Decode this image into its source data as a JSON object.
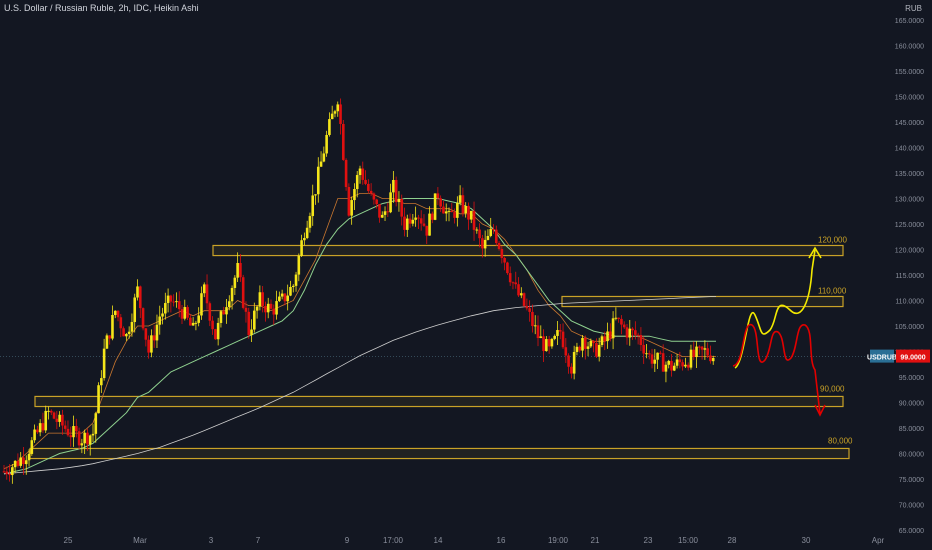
{
  "header": {
    "symbol_title": "U.S. Dollar / Russian Ruble, 2h, IDC, Heikin Ashi",
    "currency": "RUB"
  },
  "chart_data": {
    "type": "candlestick",
    "title": "U.S. Dollar / Russian Ruble, 2h, IDC, Heikin Ashi",
    "ylim": [
      65,
      165
    ],
    "y_ticks": [
      "165.0000",
      "160.0000",
      "155.0000",
      "150.0000",
      "145.0000",
      "140.0000",
      "135.0000",
      "130.0000",
      "125.0000",
      "120.0000",
      "115.0000",
      "110.0000",
      "105.0000",
      "100.0000",
      "95.0000",
      "90.0000",
      "85.0000",
      "80.0000",
      "75.0000",
      "70.0000",
      "65.0000"
    ],
    "y_tick_values": [
      165,
      160,
      155,
      150,
      145,
      140,
      135,
      130,
      125,
      120,
      115,
      110,
      105,
      100,
      95,
      90,
      85,
      80,
      75,
      70,
      65
    ],
    "x_ticks": [
      "25",
      "Mar",
      "3",
      "7",
      "9",
      "17:00",
      "14",
      "16",
      "19:00",
      "21",
      "23",
      "15:00",
      "28",
      "30",
      "Apr"
    ],
    "price_label": {
      "name": "USDRUB",
      "value": "99.0000",
      "price": 99
    },
    "zones": [
      {
        "label": "120,000",
        "low": 119.4,
        "high": 120.2
      },
      {
        "label": "110,000",
        "low": 109.4,
        "high": 110.2
      },
      {
        "label": "90,000",
        "low": 89.8,
        "high": 90.6
      },
      {
        "label": "80,000",
        "low": 79.6,
        "high": 80.4
      }
    ],
    "series": [
      {
        "name": "price_path",
        "values": [
          76.5,
          78,
          80,
          84,
          88,
          86,
          84,
          83,
          84,
          100,
          108,
          103,
          112,
          100,
          107,
          110,
          108,
          104,
          112,
          103,
          110,
          116,
          104,
          110,
          108,
          110,
          113,
          124,
          132,
          142,
          150,
          128,
          136,
          130,
          126,
          132,
          125,
          128,
          124,
          131,
          126,
          129,
          126,
          120,
          124,
          118,
          112,
          108,
          103,
          100,
          104,
          97,
          103,
          100,
          102,
          106,
          104,
          103,
          99,
          98,
          97,
          98,
          99,
          100,
          99
        ]
      },
      {
        "name": "ma_fast",
        "values": [
          77,
          78,
          80,
          82,
          84,
          84,
          84,
          84,
          86,
          92,
          98,
          102,
          105,
          105,
          106,
          107,
          108,
          107,
          108,
          108,
          108,
          110,
          109,
          109,
          108,
          109,
          110,
          114,
          118,
          124,
          130,
          130,
          131,
          131,
          130,
          130,
          129,
          129,
          128,
          128,
          128,
          127,
          127,
          125,
          124,
          122,
          119,
          116,
          112,
          109,
          107,
          104,
          103,
          102,
          102,
          103,
          103,
          103,
          102,
          101,
          100,
          99,
          99,
          99,
          99
        ]
      },
      {
        "name": "ma_mid",
        "values": [
          76,
          76.5,
          77,
          78,
          79,
          80,
          80.5,
          81,
          82,
          84,
          86,
          88,
          91,
          92,
          94,
          96,
          97,
          98,
          99,
          100,
          101,
          102,
          103,
          104,
          105,
          106,
          108,
          112,
          117,
          121,
          124,
          126,
          127,
          128,
          129,
          129.5,
          130,
          130,
          130,
          130,
          129.5,
          129,
          128,
          126,
          124,
          121,
          119,
          116,
          113,
          110,
          108,
          106,
          105,
          104,
          103.5,
          103,
          103,
          103,
          103,
          102.5,
          102,
          102,
          102,
          102,
          102
        ]
      },
      {
        "name": "ma_slow",
        "values": [
          76,
          76.2,
          76.4,
          76.6,
          76.8,
          77,
          77.3,
          77.6,
          78,
          78.5,
          79,
          79.5,
          80,
          80.6,
          81.2,
          82,
          82.8,
          83.6,
          84.5,
          85.4,
          86.3,
          87.2,
          88.1,
          89,
          90,
          91,
          92,
          93.2,
          94.4,
          95.6,
          96.8,
          98,
          99.2,
          100.2,
          101.2,
          102.2,
          103,
          103.8,
          104.5,
          105.2,
          105.8,
          106.4,
          107,
          107.5,
          108,
          108.3,
          108.6,
          108.8,
          109,
          109.2,
          109.4,
          109.5,
          109.6,
          109.7,
          109.8,
          109.9,
          110,
          110.1,
          110.2,
          110.3,
          110.4,
          110.5,
          110.6,
          110.7,
          110.8
        ]
      }
    ],
    "annotations": [
      {
        "type": "scenario-path",
        "direction": "up",
        "target": 120,
        "color": "#f2e900"
      },
      {
        "type": "scenario-path",
        "direction": "down",
        "target": 90,
        "color": "#e10000"
      }
    ],
    "colors": {
      "up": "#f5e61a",
      "down": "#e01010",
      "zone": "#c9a227",
      "ma_fast": "#c9772f",
      "ma_mid": "#8fd18f",
      "ma_slow": "#cfcfcf",
      "price_label_bg": "#e01010",
      "background": "#131722"
    }
  }
}
